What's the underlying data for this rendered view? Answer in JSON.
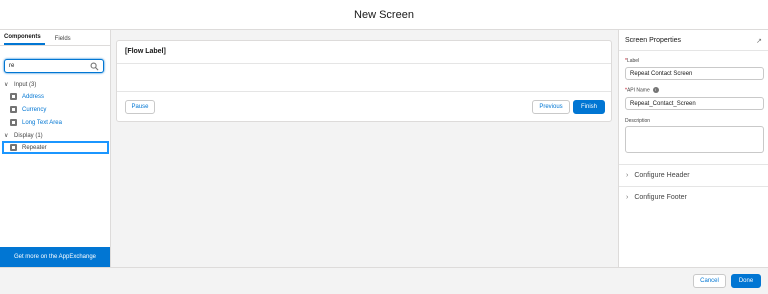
{
  "window": {
    "title": "New Screen"
  },
  "left_panel": {
    "tabs": [
      "Components",
      "Fields"
    ],
    "search": {
      "value": "re"
    },
    "groups": [
      {
        "label": "Input (3)",
        "items": [
          "Address",
          "Currency",
          "Long Text Area"
        ]
      },
      {
        "label": "Display (1)",
        "items": [
          "Repeater"
        ]
      }
    ],
    "appexchange_label": "Get more on the AppExchange"
  },
  "canvas": {
    "flow_label": "[Flow Label]",
    "pause_label": "Pause",
    "previous_label": "Previous",
    "finish_label": "Finish"
  },
  "properties": {
    "title": "Screen Properties",
    "label_field": {
      "label": "Label",
      "value": "Repeat Contact Screen"
    },
    "api_field": {
      "label": "API Name",
      "value": "Repeat_Contact_Screen"
    },
    "description_field": {
      "label": "Description",
      "value": ""
    },
    "sections": [
      "Configure Header",
      "Configure Footer"
    ]
  },
  "footer": {
    "cancel_label": "Cancel",
    "done_label": "Done"
  },
  "colors": {
    "brand": "#0176d3",
    "selection": "#1b96ff"
  }
}
